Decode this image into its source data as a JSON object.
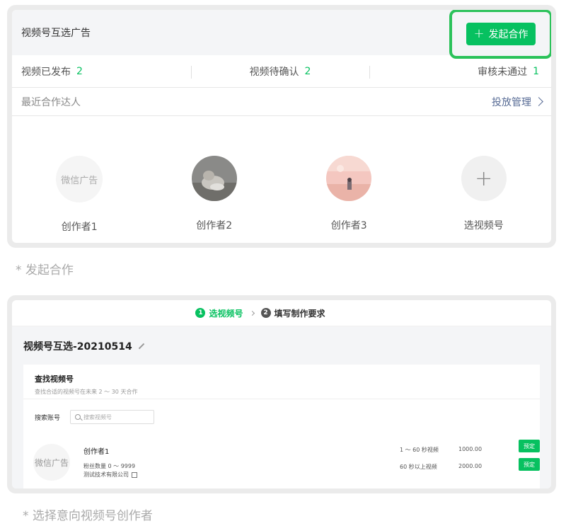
{
  "panel1": {
    "title": "视频号互选广告",
    "launch_label": "发起合作",
    "stats": [
      {
        "label": "视频已发布",
        "value": "2"
      },
      {
        "label": "视频待确认",
        "value": "2"
      },
      {
        "label": "审核未通过",
        "value": "1"
      }
    ],
    "recent_title": "最近合作达人",
    "manage_label": "投放管理",
    "creators": [
      {
        "avatar_text": "微信广告",
        "name": "创作者1"
      },
      {
        "name": "创作者2"
      },
      {
        "name": "创作者3"
      },
      {
        "name": "选视频号"
      }
    ]
  },
  "captions": {
    "first": "* 发起合作",
    "second": "* 选择意向视频号创作者"
  },
  "panel2": {
    "steps": [
      {
        "num": "1",
        "label": "选视频号"
      },
      {
        "num": "2",
        "label": "填写制作要求"
      }
    ],
    "campaign_title": "视频号互选-20210514",
    "search_title": "查找视频号",
    "search_sub": "查找合适的视频号在未来 2 ～ 30 天合作",
    "search_label": "搜索账号",
    "search_placeholder": "搜索视频号",
    "result": {
      "avatar_text": "微信广告",
      "name": "创作者1",
      "fans": "粉丝数量 0 ～ 9999",
      "company": "测试技术有限公司",
      "options": [
        {
          "label": "1 ～ 60 秒视频",
          "price": "1000.00",
          "action": "预定"
        },
        {
          "label": "60 秒以上视频",
          "price": "2000.00",
          "action": "预定"
        }
      ]
    }
  },
  "colors": {
    "accent_green": "#07c160",
    "highlight_border": "#2bc25a",
    "link_blue": "#576b95"
  }
}
